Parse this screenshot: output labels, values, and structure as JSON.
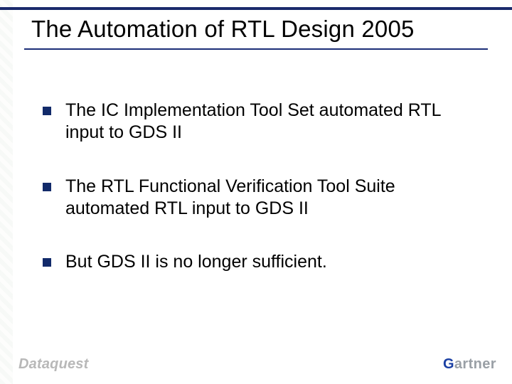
{
  "title": "The Automation of RTL Design 2005",
  "bullets": [
    "The IC Implementation Tool Set automated RTL input to GDS II",
    "The RTL Functional Verification Tool Suite automated RTL input to GDS II",
    "But GDS II is no longer sufficient."
  ],
  "footer": {
    "left_logo": "Dataquest",
    "right_logo_first": "G",
    "right_logo_rest": "artner"
  }
}
